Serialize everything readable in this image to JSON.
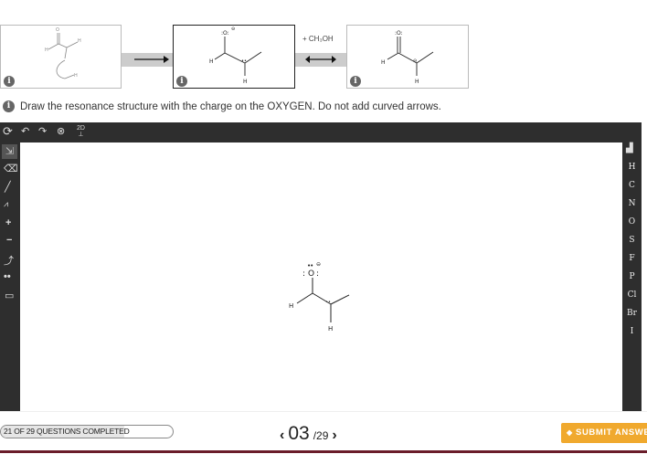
{
  "mechanism": {
    "panels": [
      {
        "name": "starting-structure"
      },
      {
        "name": "resonance-structure-selected"
      },
      {
        "name": "product-structure"
      }
    ],
    "reagent_label": "+ CH₃OH",
    "info_icon": "info-icon"
  },
  "instruction": "Draw the resonance structure with the charge on the OXYGEN. Do not add curved arrows.",
  "editor": {
    "top_tools": [
      "cycle-icon",
      "undo-icon",
      "redo-icon",
      "zoom-icon",
      "2d-icon"
    ],
    "top_tool_2d_label": "2D",
    "left_tools": [
      "select-icon",
      "eraser-icon",
      "bond-icon",
      "chain-icon",
      "plus-charge-icon",
      "minus-charge-icon",
      "arrow-icon",
      "lone-pair-icon",
      "box-icon"
    ],
    "elements": [
      "H",
      "C",
      "N",
      "O",
      "S",
      "F",
      "P",
      "Cl",
      "Br",
      "I"
    ],
    "molecule": {
      "atoms": [
        "O",
        "H",
        "H"
      ],
      "charge_symbol": "⊖"
    }
  },
  "footer": {
    "progress_text": "21 OF 29 QUESTIONS COMPLETED",
    "progress_fraction": 0.72,
    "page_current": "03",
    "page_total": "/29",
    "submit_label": "SUBMIT ANSWER",
    "accent_color": "#f0a92e"
  }
}
